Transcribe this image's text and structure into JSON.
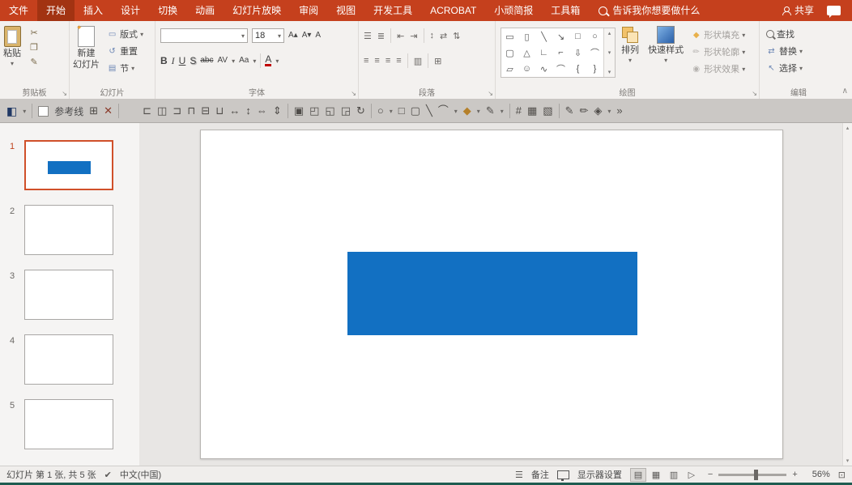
{
  "menubar": {
    "tabs": [
      "文件",
      "开始",
      "插入",
      "设计",
      "切换",
      "动画",
      "幻灯片放映",
      "审阅",
      "视图",
      "开发工具",
      "ACROBAT",
      "小顽简报",
      "工具箱"
    ],
    "active_tab": "开始",
    "tellme_text": "告诉我你想要做什么",
    "share_label": "共享"
  },
  "ribbon": {
    "clipboard": {
      "group_label": "剪贴板",
      "paste_label": "粘贴"
    },
    "slides": {
      "group_label": "幻灯片",
      "new_slide_line1": "新建",
      "new_slide_line2": "幻灯片",
      "layout_label": "版式",
      "reset_label": "重置",
      "section_label": "节"
    },
    "font": {
      "group_label": "字体",
      "font_name_value": "",
      "font_size_value": "18",
      "bold": "B",
      "italic": "I",
      "underline": "U",
      "shadow": "S",
      "strikethrough": "abc",
      "char_spacing": "AV",
      "change_case": "Aa",
      "font_color": "A"
    },
    "paragraph": {
      "group_label": "段落"
    },
    "drawing": {
      "group_label": "绘图",
      "gallery": [
        "▭",
        "▯",
        "╲",
        "↘",
        "□",
        "○",
        "▢",
        "△",
        "∟",
        "⌐",
        "⇩",
        "⌒",
        "▱",
        "☺",
        "∿",
        "⌒",
        "{",
        "}"
      ],
      "arrange_label": "排列",
      "quick_styles_label": "快速样式",
      "shape_fill_label": "形状填充",
      "shape_outline_label": "形状轮廓",
      "shape_effects_label": "形状效果"
    },
    "editing": {
      "group_label": "编辑",
      "find_label": "查找",
      "replace_label": "替换",
      "select_label": "选择"
    }
  },
  "glyphs": {
    "dropdown": "▾",
    "launcher": "↘",
    "collapse_ribbon": "∧",
    "scissors": "✂",
    "copy": "❐",
    "format_painter": "✎",
    "grow_font": "A▴",
    "shrink_font": "A▾",
    "clear_formatting": "A",
    "bullets": "☰",
    "numbering": "≣",
    "indent_decrease": "⇤",
    "indent_increase": "⇥",
    "line_spacing": "↕",
    "text_direction": "⇄",
    "align_text": "⇅",
    "align_lines": "≡",
    "columns": "▥",
    "smartart": "⊞",
    "scroll_up": "▴",
    "scroll_down": "▾",
    "layout": "▭",
    "reset": "↺",
    "section": "▤",
    "fill": "◆",
    "outline": "✏",
    "effects": "◉",
    "replace": "⇄",
    "select": "↖",
    "notes": "☰",
    "proofing": "✔",
    "view_normal": "▤",
    "view_sorter": "▦",
    "view_reading": "▥",
    "view_slideshow": "▷",
    "zoom_out": "−",
    "zoom_in": "+",
    "fit_window": "⊡",
    "more": "»"
  },
  "toolbar2": {
    "guides_label": "参考线",
    "guides_checked": false,
    "icons": [
      {
        "name": "color-fill-swatch-icon",
        "glyph": "◧"
      },
      {
        "name": "grid-icon",
        "glyph": "⊞"
      },
      {
        "name": "close-icon",
        "glyph": "✕"
      },
      {
        "name": "align-left-icon",
        "glyph": "⊏"
      },
      {
        "name": "align-center-icon",
        "glyph": "◫"
      },
      {
        "name": "align-right-icon",
        "glyph": "⊐"
      },
      {
        "name": "align-top-icon",
        "glyph": "⊓"
      },
      {
        "name": "align-middle-icon",
        "glyph": "⊟"
      },
      {
        "name": "align-bottom-icon",
        "glyph": "⊔"
      },
      {
        "name": "distribute-horizontal-icon",
        "glyph": "↔"
      },
      {
        "name": "distribute-vertical-icon",
        "glyph": "↕"
      },
      {
        "name": "equal-width-icon",
        "glyph": "⇔"
      },
      {
        "name": "equal-height-icon",
        "glyph": "⇕"
      },
      {
        "name": "group-icon",
        "glyph": "▣"
      },
      {
        "name": "ungroup-icon",
        "glyph": "◰"
      },
      {
        "name": "bring-to-front-icon",
        "glyph": "◱"
      },
      {
        "name": "send-to-back-icon",
        "glyph": "◲"
      },
      {
        "name": "rotate-icon",
        "glyph": "↻"
      },
      {
        "name": "oval-tool-icon",
        "glyph": "○"
      },
      {
        "name": "rect-tool-icon",
        "glyph": "□"
      },
      {
        "name": "rounded-rect-tool-icon",
        "glyph": "▢"
      },
      {
        "name": "line-tool-icon",
        "glyph": "╲"
      },
      {
        "name": "arc-tool-icon",
        "glyph": "⌒"
      },
      {
        "name": "fill-color-icon",
        "glyph": "◆"
      },
      {
        "name": "line-color-icon",
        "glyph": "✎"
      },
      {
        "name": "hash-grid-icon",
        "glyph": "#"
      },
      {
        "name": "image-icon",
        "glyph": "▦"
      },
      {
        "name": "screenshot-icon",
        "glyph": "▧"
      },
      {
        "name": "pencil-icon",
        "glyph": "✎"
      },
      {
        "name": "pen-icon",
        "glyph": "✏"
      },
      {
        "name": "eyedropper-icon",
        "glyph": "◈"
      },
      {
        "name": "more-tools-icon",
        "glyph": "»"
      }
    ]
  },
  "slides_panel": {
    "slides": [
      {
        "number": "1",
        "selected": true,
        "has_blue_rectangle": true
      },
      {
        "number": "2",
        "selected": false
      },
      {
        "number": "3",
        "selected": false
      },
      {
        "number": "4",
        "selected": false
      },
      {
        "number": "5",
        "selected": false
      }
    ]
  },
  "slide_canvas": {
    "shape": "blue-rectangle",
    "shape_color": "#1270c2"
  },
  "statusbar": {
    "slide_info": "幻灯片 第 1 张, 共 5 张",
    "language": "中文(中国)",
    "notes_label": "备注",
    "display_settings_label": "显示器设置",
    "zoom_value": "56%"
  },
  "colors": {
    "ribbon_red": "#c5401d",
    "active_tab_red": "#a23312",
    "selection_orange": "#d0502a",
    "shape_blue": "#1270c2",
    "bottom_strip_teal": "#1e5c50"
  }
}
